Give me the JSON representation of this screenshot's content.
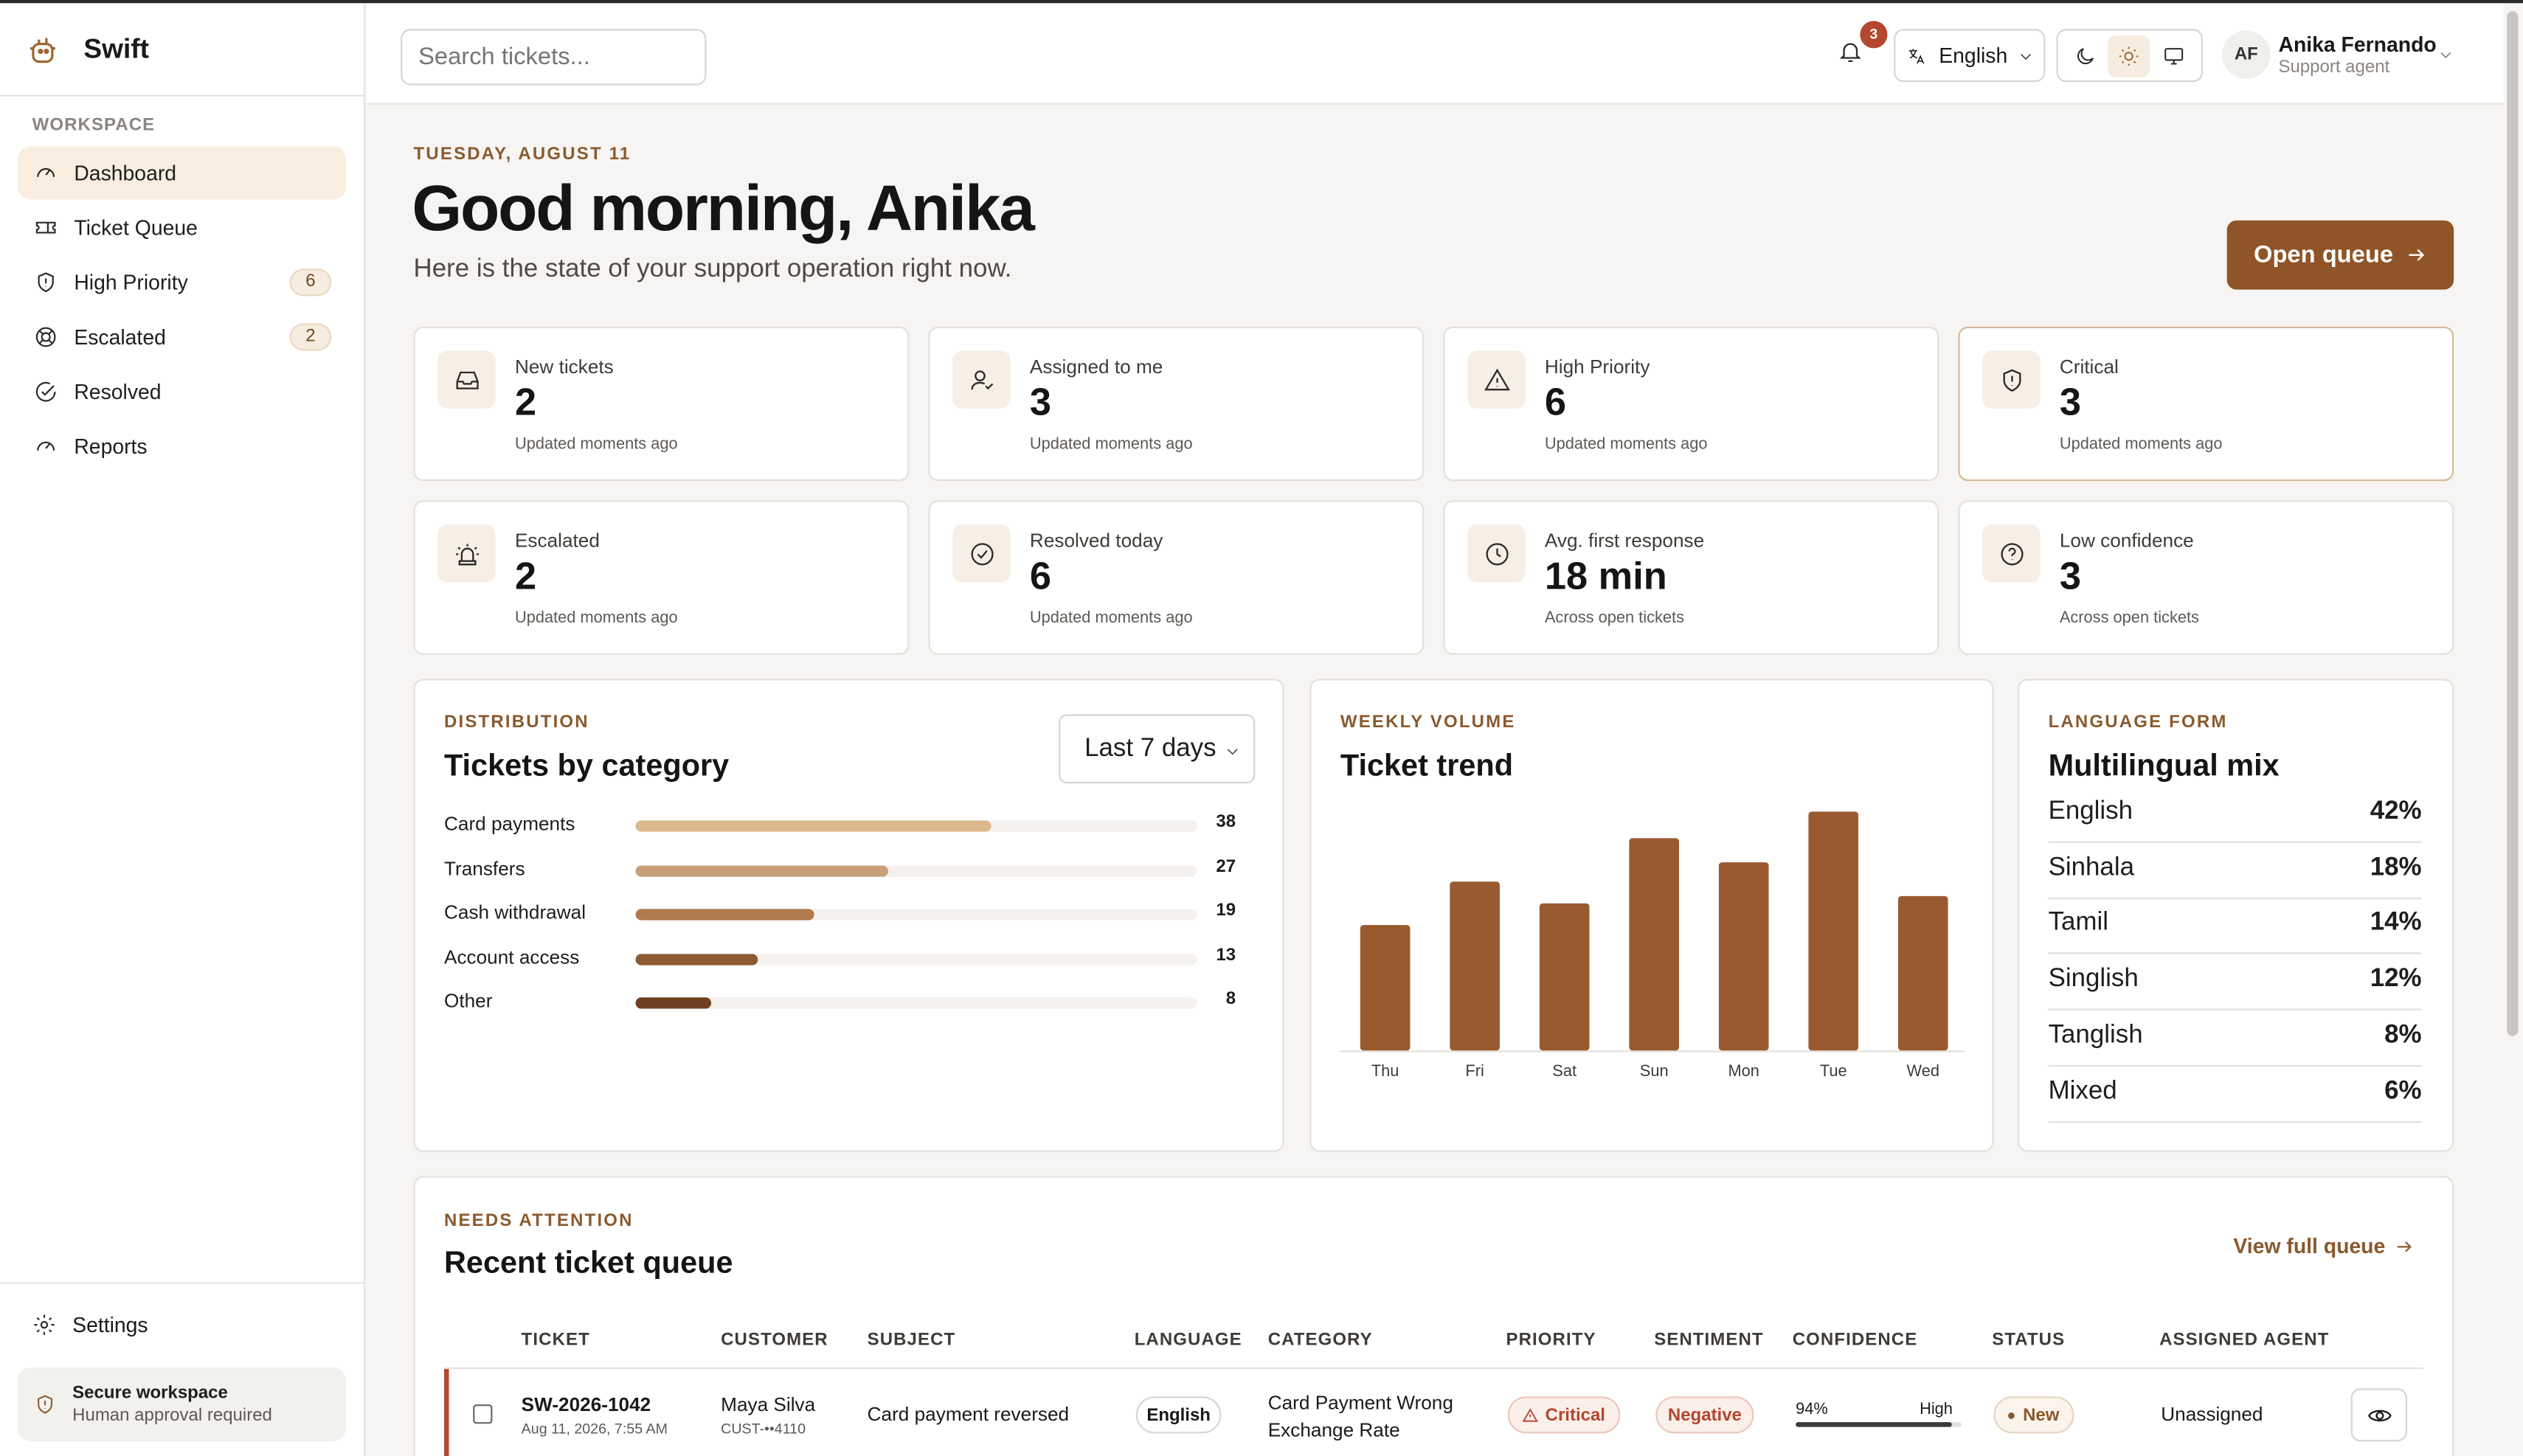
{
  "brand": {
    "name": "Swift"
  },
  "sidebar": {
    "section_label": "WORKSPACE",
    "items": [
      {
        "label": "Dashboard",
        "icon": "gauge-icon",
        "active": true
      },
      {
        "label": "Ticket Queue",
        "icon": "ticket-icon"
      },
      {
        "label": "High Priority",
        "icon": "shield-alert-icon",
        "badge": "6"
      },
      {
        "label": "Escalated",
        "icon": "lifebuoy-icon",
        "badge": "2"
      },
      {
        "label": "Resolved",
        "icon": "check-circle-icon"
      },
      {
        "label": "Reports",
        "icon": "gauge-icon"
      }
    ],
    "settings_label": "Settings",
    "secure": {
      "title": "Secure workspace",
      "subtitle": "Human approval required"
    }
  },
  "topbar": {
    "search_placeholder": "Search tickets...",
    "notifications_count": "3",
    "language": "English",
    "user": {
      "initials": "AF",
      "name": "Anika Fernando",
      "role": "Support agent"
    }
  },
  "header": {
    "date": "TUESDAY, AUGUST 11",
    "greeting": "Good morning, Anika",
    "subtitle": "Here is the state of your support operation right now.",
    "open_queue_label": "Open queue"
  },
  "stats": [
    {
      "label": "New tickets",
      "value": "2",
      "sub": "Updated moments ago",
      "icon": "inbox-icon"
    },
    {
      "label": "Assigned to me",
      "value": "3",
      "sub": "Updated moments ago",
      "icon": "user-check-icon"
    },
    {
      "label": "High Priority",
      "value": "6",
      "sub": "Updated moments ago",
      "icon": "alert-triangle-icon"
    },
    {
      "label": "Critical",
      "value": "3",
      "sub": "Updated moments ago",
      "icon": "shield-alert-icon"
    },
    {
      "label": "Escalated",
      "value": "2",
      "sub": "Updated moments ago",
      "icon": "siren-icon"
    },
    {
      "label": "Resolved today",
      "value": "6",
      "sub": "Updated moments ago",
      "icon": "check-circle-icon"
    },
    {
      "label": "Avg. first response",
      "value": "18 min",
      "sub": "Across open tickets",
      "icon": "clock-icon"
    },
    {
      "label": "Low confidence",
      "value": "3",
      "sub": "Across open tickets",
      "icon": "help-circle-icon"
    }
  ],
  "distribution": {
    "kicker": "DISTRIBUTION",
    "title": "Tickets by category",
    "range": "Last 7 days",
    "max": 60,
    "categories": [
      {
        "name": "Card payments",
        "value": 38,
        "color": "#dcb88d"
      },
      {
        "name": "Transfers",
        "value": 27,
        "color": "#c8a17a"
      },
      {
        "name": "Cash withdrawal",
        "value": 19,
        "color": "#b07a4d"
      },
      {
        "name": "Account access",
        "value": 13,
        "color": "#8c5a31"
      },
      {
        "name": "Other",
        "value": 8,
        "color": "#6e4020"
      }
    ]
  },
  "trend": {
    "kicker": "WEEKLY VOLUME",
    "title": "Ticket trend"
  },
  "chart_data": {
    "type": "bar",
    "categories": [
      "Thu",
      "Fri",
      "Sat",
      "Sun",
      "Mon",
      "Tue",
      "Wed"
    ],
    "values": [
      52,
      70,
      61,
      88,
      78,
      99,
      64
    ],
    "title": "Ticket trend",
    "xlabel": "",
    "ylabel": "",
    "ylim": [
      0,
      100
    ],
    "color": "#9a5a30"
  },
  "languages": {
    "kicker": "LANGUAGE FORM",
    "title": "Multilingual mix",
    "items": [
      {
        "name": "English",
        "pct": "42%"
      },
      {
        "name": "Sinhala",
        "pct": "18%"
      },
      {
        "name": "Tamil",
        "pct": "14%"
      },
      {
        "name": "Singlish",
        "pct": "12%"
      },
      {
        "name": "Tanglish",
        "pct": "8%"
      },
      {
        "name": "Mixed",
        "pct": "6%"
      }
    ]
  },
  "queue": {
    "kicker": "NEEDS ATTENTION",
    "title": "Recent ticket queue",
    "view_full": "View full queue",
    "columns": [
      "TICKET",
      "CUSTOMER",
      "SUBJECT",
      "LANGUAGE",
      "CATEGORY",
      "PRIORITY",
      "SENTIMENT",
      "CONFIDENCE",
      "STATUS",
      "ASSIGNED AGENT"
    ],
    "rows": [
      {
        "id": "SW-2026-1042",
        "time": "Aug 11, 2026, 7:55 AM",
        "customer": "Maya Silva",
        "customer_id": "CUST-••4110",
        "subject": "Card payment reversed",
        "language": "English",
        "category_line1": "Card Payment Wrong",
        "category_line2": "Exchange Rate",
        "priority": "Critical",
        "sentiment": "Negative",
        "confidence": "94%",
        "confidence_value": 0.94,
        "confidence_label": "High",
        "status": "New",
        "agent": "Unassigned"
      }
    ]
  }
}
